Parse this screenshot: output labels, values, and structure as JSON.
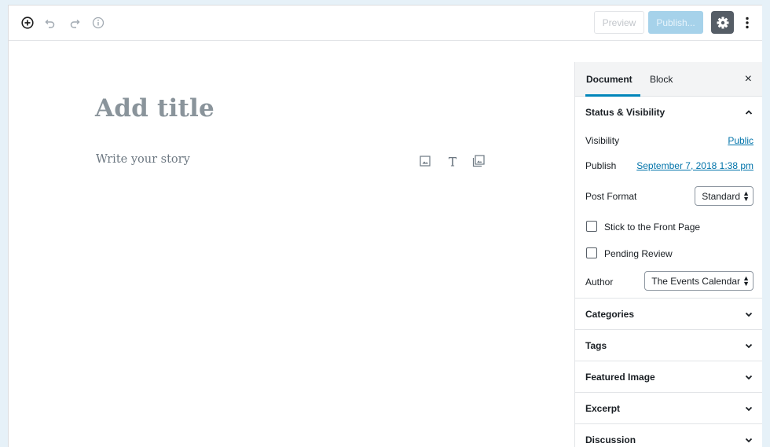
{
  "toolbar": {
    "add_icon": "plus-circle-icon",
    "undo_icon": "undo-icon",
    "redo_icon": "redo-icon",
    "info_icon": "info-icon",
    "preview_label": "Preview",
    "publish_label": "Publish...",
    "settings_icon": "gear-icon",
    "more_icon": "vertical-ellipsis-icon"
  },
  "editor": {
    "title_placeholder": "Add title",
    "body_placeholder": "Write your story",
    "inserters": [
      "image-icon",
      "paragraph-icon",
      "gallery-icon"
    ]
  },
  "sidebar": {
    "tabs": [
      {
        "label": "Document",
        "active": true
      },
      {
        "label": "Block",
        "active": false
      }
    ],
    "close_label": "×",
    "status_panel": {
      "title": "Status & Visibility",
      "visibility_label": "Visibility",
      "visibility_value": "Public",
      "publish_label": "Publish",
      "publish_value": "September 7, 2018 1:38 pm",
      "post_format_label": "Post Format",
      "post_format_value": "Standard",
      "sticky_label": "Stick to the Front Page",
      "pending_label": "Pending Review",
      "author_label": "Author",
      "author_value": "The Events Calendar"
    },
    "panels": [
      {
        "title": "Categories"
      },
      {
        "title": "Tags"
      },
      {
        "title": "Featured Image"
      },
      {
        "title": "Excerpt"
      },
      {
        "title": "Discussion"
      }
    ]
  },
  "colors": {
    "accent": "#0085ba",
    "link": "#0073aa",
    "publish_disabled": "#a6d2ea",
    "settings_active": "#555d66"
  }
}
